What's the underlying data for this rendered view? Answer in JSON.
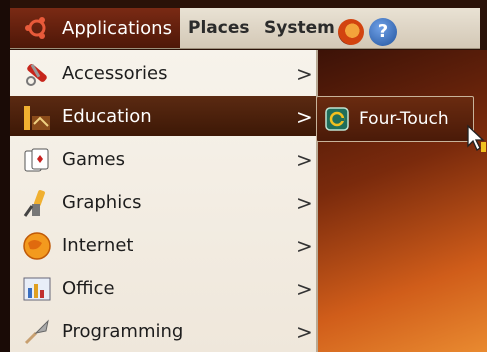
{
  "topbar": {
    "applications": "Applications",
    "places": "Places",
    "system": "System",
    "help_glyph": "?"
  },
  "menu": {
    "items": [
      {
        "label": "Accessories",
        "icon": "scissors-icon"
      },
      {
        "label": "Education",
        "icon": "education-icon",
        "active": true
      },
      {
        "label": "Games",
        "icon": "cards-icon"
      },
      {
        "label": "Graphics",
        "icon": "brush-icon"
      },
      {
        "label": "Internet",
        "icon": "globe-icon"
      },
      {
        "label": "Office",
        "icon": "chart-icon"
      },
      {
        "label": "Programming",
        "icon": "trowel-icon"
      }
    ],
    "arrow": ">"
  },
  "submenu": {
    "items": [
      {
        "label": "Four-Touch",
        "icon": "four-touch-icon"
      }
    ]
  },
  "colors": {
    "menu_bg": "#f3ede2",
    "active_bg": "#4e1f0a",
    "desktop_orange": "#d05d1a",
    "topbar_bg": "#e3dbcc"
  }
}
